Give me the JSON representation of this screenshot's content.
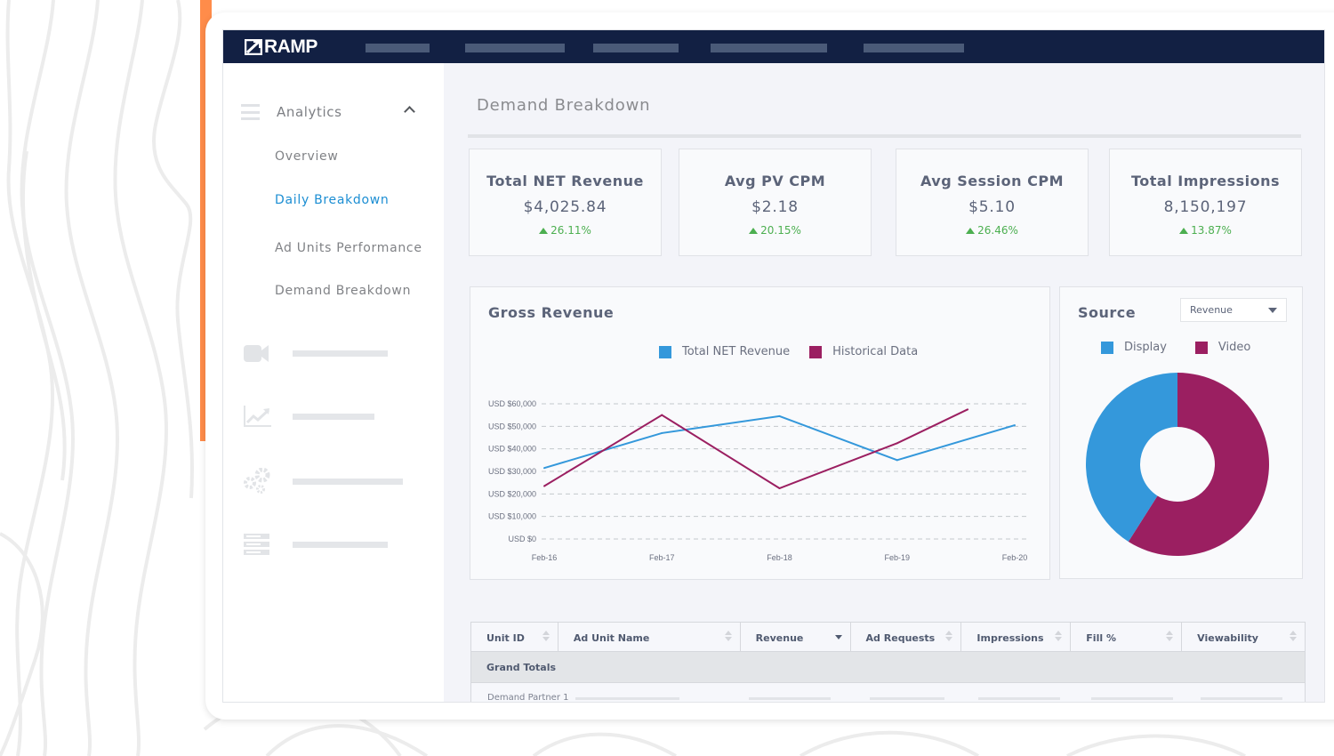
{
  "app": {
    "brand": "RAMP",
    "nav_placeholders": 5
  },
  "sidebar": {
    "section_label": "Analytics",
    "section_expanded": true,
    "items": [
      {
        "label": "Overview",
        "active": false
      },
      {
        "label": "Daily Breakdown",
        "active": true
      },
      {
        "label": "Ad Units Performance",
        "active": false
      },
      {
        "label": "Demand Breakdown",
        "active": false
      }
    ],
    "icon_items": [
      {
        "icon": "video-camera-icon"
      },
      {
        "icon": "line-chart-icon"
      },
      {
        "icon": "gears-icon"
      },
      {
        "icon": "server-list-icon"
      }
    ]
  },
  "page": {
    "title": "Demand Breakdown"
  },
  "kpis": [
    {
      "label": "Total NET Revenue",
      "value": "$4,025.84",
      "delta": "26.11%",
      "direction": "up"
    },
    {
      "label": "Avg PV CPM",
      "value": "$2.18",
      "delta": "20.15%",
      "direction": "up"
    },
    {
      "label": "Avg Session CPM",
      "value": "$5.10",
      "delta": "26.46%",
      "direction": "up"
    },
    {
      "label": "Total Impressions",
      "value": "8,150,197",
      "delta": "13.87%",
      "direction": "up"
    }
  ],
  "colors": {
    "blue": "#3498db",
    "purple": "#9b1f61",
    "positive": "#4caf50",
    "navy": "#122043",
    "accent_orange": "#ff8c4a",
    "active_link": "#1c8ed3"
  },
  "source_card": {
    "title": "Source",
    "metric_select": "Revenue"
  },
  "chart_data": [
    {
      "type": "line",
      "title": "Gross Revenue",
      "xlabel": "",
      "ylabel": "",
      "x": [
        "Feb-16",
        "Feb-17",
        "Feb-18",
        "Feb-19",
        "Feb-20"
      ],
      "ylim": [
        0,
        60000
      ],
      "yticks": [
        0,
        10000,
        20000,
        30000,
        40000,
        50000,
        60000
      ],
      "ytick_labels": [
        "USD $0",
        "USD $10,000",
        "USD $20,000",
        "USD $30,000",
        "USD $40,000",
        "USD $50,000",
        "USD $60,000"
      ],
      "grid": true,
      "legend_position": "top-center",
      "series": [
        {
          "name": "Total NET Revenue",
          "color": "#3498db",
          "x_index": [
            0,
            1,
            2,
            3,
            4
          ],
          "values": [
            31500,
            47000,
            54500,
            35000,
            50500
          ]
        },
        {
          "name": "Historical Data",
          "color": "#9b1f61",
          "x_index": [
            0,
            1,
            2,
            3,
            3.6
          ],
          "values": [
            23500,
            55000,
            22500,
            42500,
            57500
          ]
        }
      ]
    },
    {
      "type": "pie",
      "title": "Source",
      "donut": true,
      "legend_position": "top-center",
      "labels": [
        "Video",
        "Display"
      ],
      "values": [
        59,
        41
      ],
      "colors": [
        "#9b1f61",
        "#3498db"
      ]
    }
  ],
  "table": {
    "columns": [
      {
        "label": "Unit ID",
        "sort": "none"
      },
      {
        "label": "Ad Unit Name",
        "sort": "none"
      },
      {
        "label": "Revenue",
        "sort": "desc"
      },
      {
        "label": "Ad Requests",
        "sort": "none"
      },
      {
        "label": "Impressions",
        "sort": "none"
      },
      {
        "label": "Fill %",
        "sort": "none"
      },
      {
        "label": "Viewability",
        "sort": "none"
      }
    ],
    "totals_label": "Grand Totals",
    "rows": [
      {
        "label": "Demand Partner 1"
      }
    ]
  }
}
